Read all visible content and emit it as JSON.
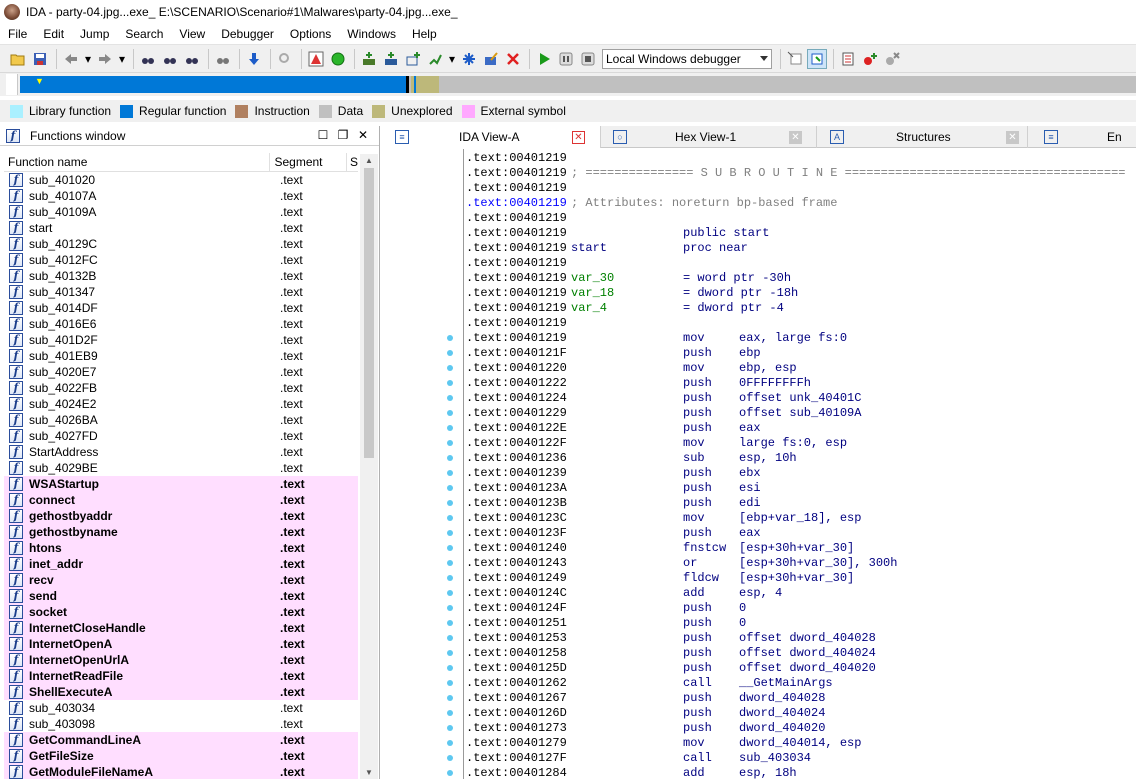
{
  "window": {
    "title": "IDA - party-04.jpg...exe_ E:\\SCENARIO\\Scenario#1\\Malwares\\party-04.jpg...exe_"
  },
  "menu": [
    "File",
    "Edit",
    "Jump",
    "Search",
    "View",
    "Debugger",
    "Options",
    "Windows",
    "Help"
  ],
  "toolbar": {
    "debugger_select": "Local Windows debugger"
  },
  "legend": [
    {
      "label": "Library function",
      "color": "#aaf0ff"
    },
    {
      "label": "Regular function",
      "color": "#0078d7"
    },
    {
      "label": "Instruction",
      "color": "#b08060"
    },
    {
      "label": "Data",
      "color": "#c0c0c0"
    },
    {
      "label": "Unexplored",
      "color": "#bdb87a"
    },
    {
      "label": "External symbol",
      "color": "#ffa8ff"
    }
  ],
  "functions_window": {
    "title": "Functions window",
    "col_name": "Function name",
    "col_segment": "Segment",
    "col_start": "S",
    "rows": [
      {
        "name": "sub_401020",
        "seg": ".text",
        "ext": false
      },
      {
        "name": "sub_40107A",
        "seg": ".text",
        "ext": false
      },
      {
        "name": "sub_40109A",
        "seg": ".text",
        "ext": false
      },
      {
        "name": "start",
        "seg": ".text",
        "ext": false
      },
      {
        "name": "sub_40129C",
        "seg": ".text",
        "ext": false
      },
      {
        "name": "sub_4012FC",
        "seg": ".text",
        "ext": false
      },
      {
        "name": "sub_40132B",
        "seg": ".text",
        "ext": false
      },
      {
        "name": "sub_401347",
        "seg": ".text",
        "ext": false
      },
      {
        "name": "sub_4014DF",
        "seg": ".text",
        "ext": false
      },
      {
        "name": "sub_4016E6",
        "seg": ".text",
        "ext": false
      },
      {
        "name": "sub_401D2F",
        "seg": ".text",
        "ext": false
      },
      {
        "name": "sub_401EB9",
        "seg": ".text",
        "ext": false
      },
      {
        "name": "sub_4020E7",
        "seg": ".text",
        "ext": false
      },
      {
        "name": "sub_4022FB",
        "seg": ".text",
        "ext": false
      },
      {
        "name": "sub_4024E2",
        "seg": ".text",
        "ext": false
      },
      {
        "name": "sub_4026BA",
        "seg": ".text",
        "ext": false
      },
      {
        "name": "sub_4027FD",
        "seg": ".text",
        "ext": false
      },
      {
        "name": "StartAddress",
        "seg": ".text",
        "ext": false
      },
      {
        "name": "sub_4029BE",
        "seg": ".text",
        "ext": false
      },
      {
        "name": "WSAStartup",
        "seg": ".text",
        "ext": true
      },
      {
        "name": "connect",
        "seg": ".text",
        "ext": true
      },
      {
        "name": "gethostbyaddr",
        "seg": ".text",
        "ext": true
      },
      {
        "name": "gethostbyname",
        "seg": ".text",
        "ext": true
      },
      {
        "name": "htons",
        "seg": ".text",
        "ext": true
      },
      {
        "name": "inet_addr",
        "seg": ".text",
        "ext": true
      },
      {
        "name": "recv",
        "seg": ".text",
        "ext": true
      },
      {
        "name": "send",
        "seg": ".text",
        "ext": true
      },
      {
        "name": "socket",
        "seg": ".text",
        "ext": true
      },
      {
        "name": "InternetCloseHandle",
        "seg": ".text",
        "ext": true
      },
      {
        "name": "InternetOpenA",
        "seg": ".text",
        "ext": true
      },
      {
        "name": "InternetOpenUrlA",
        "seg": ".text",
        "ext": true
      },
      {
        "name": "InternetReadFile",
        "seg": ".text",
        "ext": true
      },
      {
        "name": "ShellExecuteA",
        "seg": ".text",
        "ext": true
      },
      {
        "name": "sub_403034",
        "seg": ".text",
        "ext": false
      },
      {
        "name": "sub_403098",
        "seg": ".text",
        "ext": false
      },
      {
        "name": "GetCommandLineA",
        "seg": ".text",
        "ext": true
      },
      {
        "name": "GetFileSize",
        "seg": ".text",
        "ext": true
      },
      {
        "name": "GetModuleFileNameA",
        "seg": ".text",
        "ext": true
      }
    ]
  },
  "tabs": [
    {
      "label": "IDA View-A",
      "active": true
    },
    {
      "label": "Hex View-1",
      "active": false
    },
    {
      "label": "Structures",
      "active": false
    },
    {
      "label": "En",
      "active": false
    }
  ],
  "ida_view": {
    "lines": [
      {
        "addr": ".text:00401219",
        "kind": "plain",
        "text": ""
      },
      {
        "addr": ".text:00401219",
        "kind": "comment",
        "text": "; =============== S U B R O U T I N E ======================================="
      },
      {
        "addr": ".text:00401219",
        "kind": "plain",
        "text": ""
      },
      {
        "addr": ".text:00401219",
        "kind": "comment",
        "hl": true,
        "text": "; Attributes: noreturn bp-based frame"
      },
      {
        "addr": ".text:00401219",
        "kind": "plain",
        "text": ""
      },
      {
        "addr": ".text:00401219",
        "kind": "ins",
        "mn": "public start",
        "op": ""
      },
      {
        "addr": ".text:00401219",
        "kind": "label",
        "label": "start",
        "mn": "proc near",
        "op": ""
      },
      {
        "addr": ".text:00401219",
        "kind": "plain",
        "text": ""
      },
      {
        "addr": ".text:00401219",
        "kind": "var",
        "label": "var_30",
        "mn": "= word ptr -30h",
        "op": ""
      },
      {
        "addr": ".text:00401219",
        "kind": "var",
        "label": "var_18",
        "mn": "= dword ptr -18h",
        "op": ""
      },
      {
        "addr": ".text:00401219",
        "kind": "var",
        "label": "var_4",
        "mn": "= dword ptr -4",
        "op": ""
      },
      {
        "addr": ".text:00401219",
        "kind": "plain",
        "text": ""
      },
      {
        "addr": ".text:00401219",
        "kind": "ins",
        "mn": "mov",
        "op": "eax, large fs:0",
        "dot": true
      },
      {
        "addr": ".text:0040121F",
        "kind": "ins",
        "mn": "push",
        "op": "ebp",
        "dot": true
      },
      {
        "addr": ".text:00401220",
        "kind": "ins",
        "mn": "mov",
        "op": "ebp, esp",
        "dot": true
      },
      {
        "addr": ".text:00401222",
        "kind": "ins",
        "mn": "push",
        "op": "0FFFFFFFFh",
        "dot": true
      },
      {
        "addr": ".text:00401224",
        "kind": "ins",
        "mn": "push",
        "op": "offset unk_40401C",
        "dot": true
      },
      {
        "addr": ".text:00401229",
        "kind": "ins",
        "mn": "push",
        "op": "offset sub_40109A",
        "dot": true
      },
      {
        "addr": ".text:0040122E",
        "kind": "ins",
        "mn": "push",
        "op": "eax",
        "dot": true
      },
      {
        "addr": ".text:0040122F",
        "kind": "ins",
        "mn": "mov",
        "op": "large fs:0, esp",
        "dot": true
      },
      {
        "addr": ".text:00401236",
        "kind": "ins",
        "mn": "sub",
        "op": "esp, 10h",
        "dot": true
      },
      {
        "addr": ".text:00401239",
        "kind": "ins",
        "mn": "push",
        "op": "ebx",
        "dot": true
      },
      {
        "addr": ".text:0040123A",
        "kind": "ins",
        "mn": "push",
        "op": "esi",
        "dot": true
      },
      {
        "addr": ".text:0040123B",
        "kind": "ins",
        "mn": "push",
        "op": "edi",
        "dot": true
      },
      {
        "addr": ".text:0040123C",
        "kind": "ins",
        "mn": "mov",
        "op": "[ebp+var_18], esp",
        "dot": true
      },
      {
        "addr": ".text:0040123F",
        "kind": "ins",
        "mn": "push",
        "op": "eax",
        "dot": true
      },
      {
        "addr": ".text:00401240",
        "kind": "ins",
        "mn": "fnstcw",
        "op": "[esp+30h+var_30]",
        "dot": true
      },
      {
        "addr": ".text:00401243",
        "kind": "ins",
        "mn": "or",
        "op": "[esp+30h+var_30], 300h",
        "dot": true
      },
      {
        "addr": ".text:00401249",
        "kind": "ins",
        "mn": "fldcw",
        "op": "[esp+30h+var_30]",
        "dot": true
      },
      {
        "addr": ".text:0040124C",
        "kind": "ins",
        "mn": "add",
        "op": "esp, 4",
        "dot": true
      },
      {
        "addr": ".text:0040124F",
        "kind": "ins",
        "mn": "push",
        "op": "0",
        "dot": true
      },
      {
        "addr": ".text:00401251",
        "kind": "ins",
        "mn": "push",
        "op": "0",
        "dot": true
      },
      {
        "addr": ".text:00401253",
        "kind": "ins",
        "mn": "push",
        "op": "offset dword_404028",
        "dot": true
      },
      {
        "addr": ".text:00401258",
        "kind": "ins",
        "mn": "push",
        "op": "offset dword_404024",
        "dot": true
      },
      {
        "addr": ".text:0040125D",
        "kind": "ins",
        "mn": "push",
        "op": "offset dword_404020",
        "dot": true
      },
      {
        "addr": ".text:00401262",
        "kind": "ins",
        "mn": "call",
        "op": "__GetMainArgs",
        "dot": true
      },
      {
        "addr": ".text:00401267",
        "kind": "ins",
        "mn": "push",
        "op": "dword_404028",
        "dot": true
      },
      {
        "addr": ".text:0040126D",
        "kind": "ins",
        "mn": "push",
        "op": "dword_404024",
        "dot": true
      },
      {
        "addr": ".text:00401273",
        "kind": "ins",
        "mn": "push",
        "op": "dword_404020",
        "dot": true
      },
      {
        "addr": ".text:00401279",
        "kind": "ins",
        "mn": "mov",
        "op": "dword_404014, esp",
        "dot": true
      },
      {
        "addr": ".text:0040127F",
        "kind": "ins",
        "mn": "call",
        "op": "sub_403034",
        "dot": true
      },
      {
        "addr": ".text:00401284",
        "kind": "ins",
        "mn": "add",
        "op": "esp, 18h",
        "dot": true
      }
    ]
  }
}
